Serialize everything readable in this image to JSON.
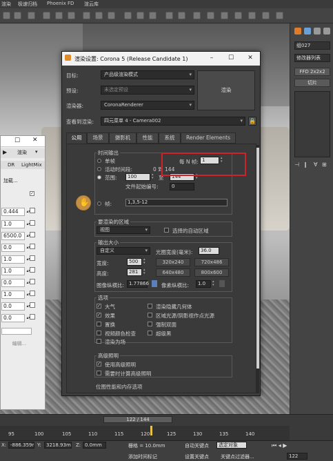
{
  "menu": {
    "items": [
      "渲染",
      "极速归档",
      "Phoenix FD",
      "渲云库"
    ]
  },
  "dialog": {
    "title": "渲染设置: Corona 5 (Release Candidate 1)",
    "target_label": "目标:",
    "target_value": "产品级渲染模式",
    "preset_label": "预设:",
    "preset_value": "未选定预设",
    "renderer_label": "渲染器:",
    "renderer_value": "CoronaRenderer",
    "view_label": "查看到渲染:",
    "view_value": "四元菜单 4 - Camera002",
    "render_button": "渲染",
    "tabs": [
      "公用",
      "场景",
      "摄影机",
      "性能",
      "系统",
      "Render Elements"
    ],
    "time_output": {
      "title": "时间输出",
      "single": "单帧",
      "every_nth_label": "每 N 帧:",
      "every_nth_value": "1",
      "active_segment": "活动时间段:",
      "active_segment_value": "0 到 144",
      "range": "范围:",
      "range_from": "100",
      "range_to_label": "至",
      "range_to": "144",
      "file_start_label": "文件起始编号:",
      "file_start_value": "0",
      "frames_label": "帧:",
      "frames_value": "1,3,5-12"
    },
    "area": {
      "title": "要渲染的区域",
      "select_value": "视图",
      "auto_region_label": "选择的自动区域"
    },
    "output_size": {
      "title": "输出大小",
      "select_value": "自定义",
      "aperture_label": "光圈宽度(毫米):",
      "aperture_value": "36.0",
      "width_label": "宽度:",
      "width_value": "500",
      "height_label": "高度:",
      "height_value": "281",
      "presets": [
        "320x240",
        "720x486",
        "640x480",
        "800x600"
      ],
      "image_aspect_label": "图像纵横比:",
      "image_aspect_value": "1.77866",
      "pixel_aspect_label": "像素纵横比:",
      "pixel_aspect_value": "1.0"
    },
    "options": {
      "title": "选项",
      "items": [
        {
          "label": "大气",
          "checked": true
        },
        {
          "label": "渲染隐藏几何体",
          "checked": false
        },
        {
          "label": "效果",
          "checked": true
        },
        {
          "label": "区域光源/阴影视作点光源",
          "checked": false
        },
        {
          "label": "置换",
          "checked": false
        },
        {
          "label": "强制双面",
          "checked": false
        },
        {
          "label": "视频颜色检查",
          "checked": false
        },
        {
          "label": "超级黑",
          "checked": false
        },
        {
          "label": "渲染为场",
          "checked": false
        }
      ]
    },
    "advanced_lighting": {
      "title": "高级照明",
      "use_label": "使用高级照明",
      "compute_label": "需要时计算高级照明"
    },
    "bitmap_section": "位图性能和内存选项"
  },
  "left_panel": {
    "tabs": [
      "DR",
      "LightMix"
    ],
    "add_button": "加载...",
    "render_button": "渲染",
    "values": [
      "0.444",
      "1.0",
      "6500.0",
      "0.0",
      "1.0",
      "1.0",
      "0.0",
      "1.0",
      "0.0",
      "0.0"
    ],
    "edit_button": "编辑..."
  },
  "right_panel": {
    "object_name": "组027",
    "modifier_list": "修改器列表",
    "ffd_button": "FFD 2x2x2",
    "slice_button": "切片"
  },
  "timeline": {
    "frame_display": "122 / 144",
    "ticks": [
      "95",
      "100",
      "105",
      "110",
      "115",
      "120",
      "125",
      "130",
      "135",
      "140"
    ]
  },
  "statusbar": {
    "x_label": "X:",
    "x_value": "-886.359m",
    "y_label": "Y:",
    "y_value": "3218.93m",
    "z_label": "Z:",
    "z_value": "0.0mm",
    "grid_label": "栅格 = 10.0mm",
    "auto_key": "自动关键点",
    "selected_obj": "选定对象",
    "set_key": "设置关键点",
    "key_filter": "关键点过滤器...",
    "add_time_tag": "添加时间标记",
    "frame": "122"
  }
}
